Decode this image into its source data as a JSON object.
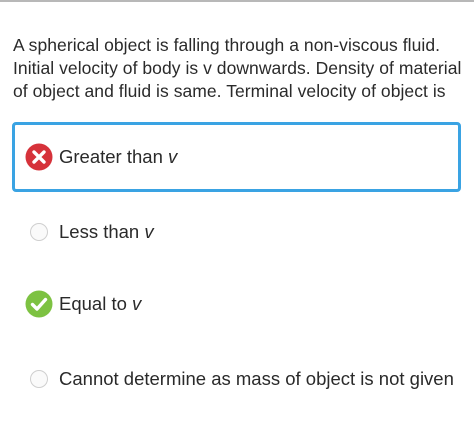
{
  "question": {
    "text": "A spherical object is falling through a non-viscous fluid. Initial velocity of body is v downwards. Density of material of object and fluid is same. Terminal velocity of object is"
  },
  "options": [
    {
      "label": "Greater than ",
      "var": "v",
      "state": "selected-wrong",
      "icon": "wrong-cross-icon"
    },
    {
      "label": "Less than ",
      "var": "v",
      "state": "unselected",
      "icon": "radio-empty-icon"
    },
    {
      "label": "Equal to ",
      "var": "v",
      "state": "correct",
      "icon": "correct-check-icon"
    },
    {
      "label": "Cannot determine as mass of object is not given",
      "var": "",
      "state": "unselected",
      "icon": "radio-empty-icon"
    }
  ],
  "colors": {
    "selected_border": "#3aa3e3",
    "wrong": "#d6323a",
    "correct": "#7dc242",
    "text": "#2a2a2a"
  }
}
